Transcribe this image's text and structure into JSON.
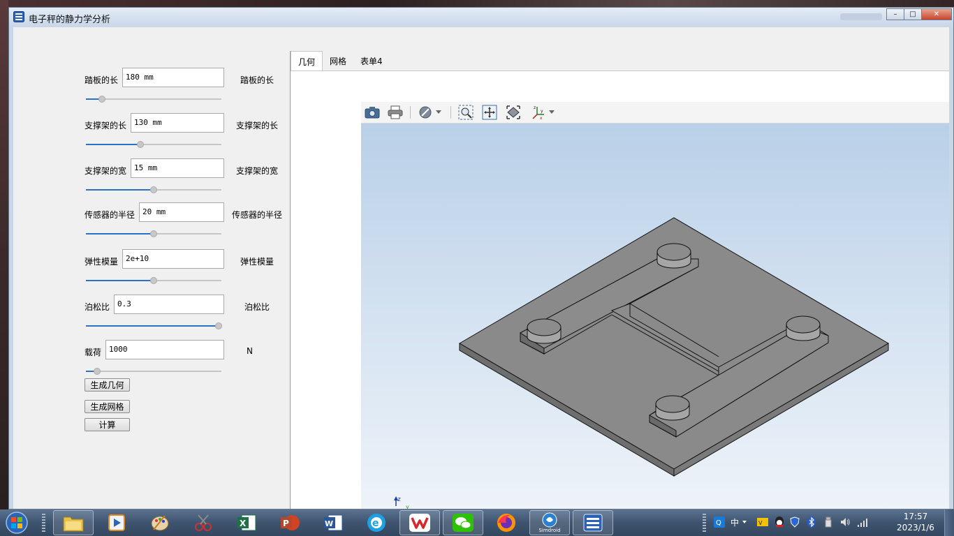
{
  "window": {
    "title": "电子秤的静力学分析",
    "controls": {
      "minimize": "–",
      "maximize": "□",
      "close": "✕"
    }
  },
  "params": [
    {
      "label": "踏板的长",
      "value": "180 mm",
      "unit_label": "踏板的长",
      "slider": 0.12
    },
    {
      "label": "支撑架的长",
      "value": "130 mm",
      "unit_label": "支撑架的长",
      "slider": 0.4
    },
    {
      "label": "支撑架的宽",
      "value": "15 mm",
      "unit_label": "支撑架的宽",
      "slider": 0.5
    },
    {
      "label": "传感器的半径",
      "value": "20 mm",
      "unit_label": "传感器的半径",
      "slider": 0.5
    },
    {
      "label": "弹性模量",
      "value": "2e+10",
      "unit_label": "弹性模量",
      "slider": 0.5
    },
    {
      "label": "泊松比",
      "value": "0.3",
      "unit_label": "泊松比",
      "slider": 0.98
    },
    {
      "label": "载荷",
      "value": "1000",
      "unit_label": "N",
      "slider": 0.08
    }
  ],
  "buttons": {
    "generate_geometry": "生成几何",
    "generate_mesh": "生成网格",
    "compute": "计算"
  },
  "tabs": [
    {
      "label": "几何",
      "active": true
    },
    {
      "label": "网格",
      "active": false
    },
    {
      "label": "表单4",
      "active": false
    }
  ],
  "viewer": {
    "toolbar": [
      "camera-icon",
      "print-icon",
      "hide-icon",
      "zoom-box-icon",
      "zoom-extents-icon",
      "view-fit-icon",
      "axes-icon"
    ],
    "axis_labels": {
      "z": "z",
      "y": "y",
      "x": "x"
    }
  },
  "taskbar": {
    "apps": [
      "file-explorer",
      "media-player",
      "paint",
      "snipping-tool",
      "excel",
      "powerpoint",
      "word",
      "edge",
      "wps",
      "wechat",
      "firefox",
      "simdroid",
      "electronic-scale-app"
    ],
    "simdroid_label": "Simdroid",
    "tray": {
      "ime_mode": "中"
    },
    "clock": {
      "time": "17:57",
      "date": "2023/1/6"
    }
  },
  "colors": {
    "accent": "#2a72c8",
    "viewport_top": "#b9d0e8",
    "model_gray": "#8a8a8a"
  }
}
